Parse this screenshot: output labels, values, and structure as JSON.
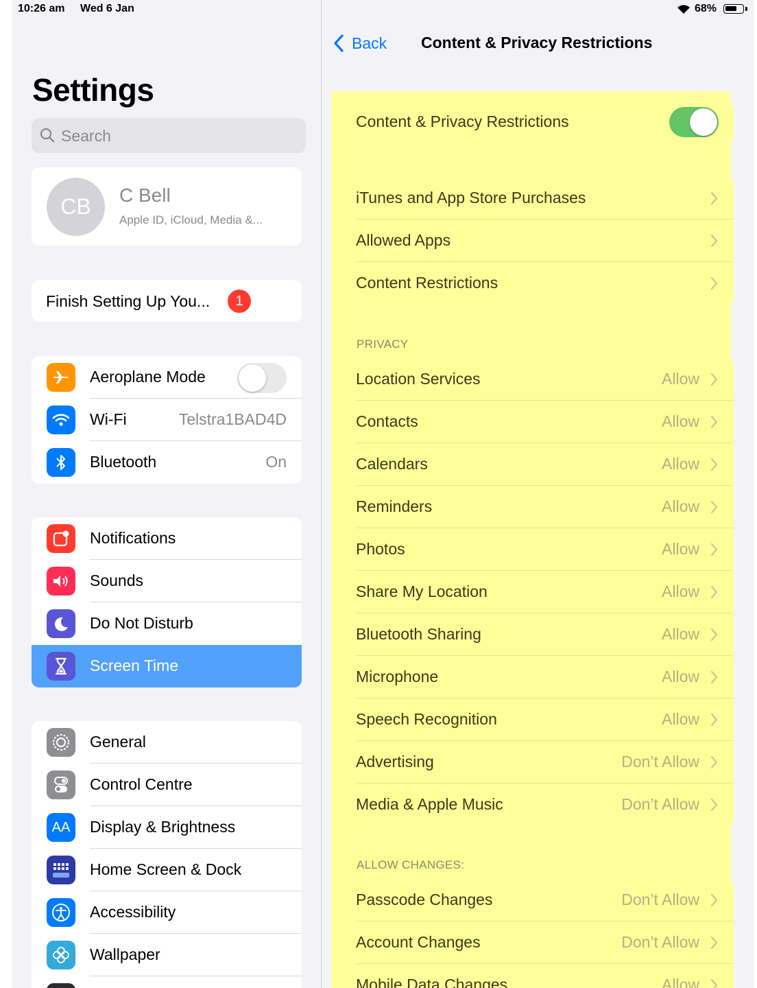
{
  "status_bar": {
    "time": "10:26 am",
    "date": "Wed 6 Jan",
    "battery_percent": "68%",
    "battery_level": 0.68
  },
  "sidebar": {
    "title": "Settings",
    "search_placeholder": "Search",
    "profile": {
      "initials": "CB",
      "name": "C Bell",
      "subtitle": "Apple ID, iCloud, Media &..."
    },
    "finish_setup": {
      "label": "Finish Setting Up You...",
      "badge": "1"
    },
    "groups": [
      {
        "items": [
          {
            "label": "Aeroplane Mode",
            "icon": "airplane-icon",
            "color": "#ff9500",
            "toggle": false
          },
          {
            "label": "Wi-Fi",
            "icon": "wifi-icon",
            "color": "#007aff",
            "value": "Telstra1BAD4D"
          },
          {
            "label": "Bluetooth",
            "icon": "bluetooth-icon",
            "color": "#007aff",
            "value": "On"
          }
        ]
      },
      {
        "items": [
          {
            "label": "Notifications",
            "icon": "notifications-icon",
            "color": "#ff3b30"
          },
          {
            "label": "Sounds",
            "icon": "speaker-icon",
            "color": "#ff2d55"
          },
          {
            "label": "Do Not Disturb",
            "icon": "moon-icon",
            "color": "#5856d6"
          },
          {
            "label": "Screen Time",
            "icon": "hourglass-icon",
            "color": "#5856d6",
            "selected": true
          }
        ]
      },
      {
        "items": [
          {
            "label": "General",
            "icon": "gear-icon",
            "color": "#8e8e93"
          },
          {
            "label": "Control Centre",
            "icon": "switches-icon",
            "color": "#8e8e93"
          },
          {
            "label": "Display & Brightness",
            "icon": "text-size-icon",
            "color": "#007aff"
          },
          {
            "label": "Home Screen & Dock",
            "icon": "app-grid-icon",
            "color": "#2c3aa8"
          },
          {
            "label": "Accessibility",
            "icon": "accessibility-icon",
            "color": "#007aff"
          },
          {
            "label": "Wallpaper",
            "icon": "flower-icon",
            "color": "#34aadc"
          }
        ]
      }
    ]
  },
  "detail": {
    "back_label": "Back",
    "title": "Content & Privacy Restrictions",
    "highlight_color": "#ffff99",
    "master_toggle": {
      "label": "Content & Privacy Restrictions",
      "on": true
    },
    "store_group": [
      {
        "label": "iTunes and App Store Purchases"
      },
      {
        "label": "Allowed Apps"
      },
      {
        "label": "Content Restrictions"
      }
    ],
    "privacy_header": "PRIVACY",
    "privacy_items": [
      {
        "label": "Location Services",
        "value": "Allow"
      },
      {
        "label": "Contacts",
        "value": "Allow"
      },
      {
        "label": "Calendars",
        "value": "Allow"
      },
      {
        "label": "Reminders",
        "value": "Allow"
      },
      {
        "label": "Photos",
        "value": "Allow"
      },
      {
        "label": "Share My Location",
        "value": "Allow"
      },
      {
        "label": "Bluetooth Sharing",
        "value": "Allow"
      },
      {
        "label": "Microphone",
        "value": "Allow"
      },
      {
        "label": "Speech Recognition",
        "value": "Allow"
      },
      {
        "label": "Advertising",
        "value": "Don’t Allow"
      },
      {
        "label": "Media & Apple Music",
        "value": "Don’t Allow"
      }
    ],
    "allow_changes_header": "ALLOW CHANGES:",
    "allow_changes_items": [
      {
        "label": "Passcode Changes",
        "value": "Don’t Allow"
      },
      {
        "label": "Account Changes",
        "value": "Don’t Allow"
      },
      {
        "label": "Mobile Data Changes",
        "value": "Allow"
      }
    ]
  }
}
